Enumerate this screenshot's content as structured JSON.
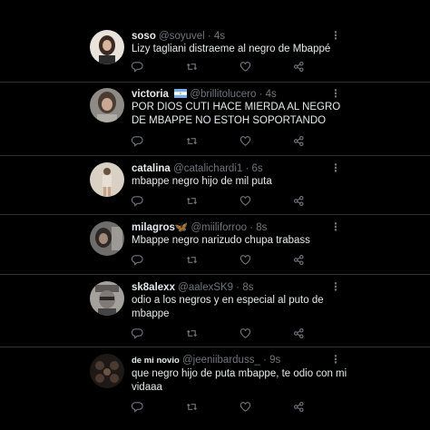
{
  "tweets": [
    {
      "name": "soso",
      "handle": "@soyuvel",
      "time": "4s",
      "text": "Lizy tagliani distraeme al negro de Mbappé",
      "avatar_color": "#d9cfc5"
    },
    {
      "name": "victoria",
      "handle": "@brillitolucero",
      "time": "4s",
      "text": "POR DIOS CUTI HACE MIERDA AL NEGRO DE MBAPPE NO ESTOH SOPORTANDO",
      "avatar_color": "#8d8a86",
      "flag": "argentina-flag-icon"
    },
    {
      "name": "catalina",
      "handle": "@catalichardi1",
      "time": "6s",
      "text": "mbappe negro hijo de mil puta",
      "avatar_color": "#cfc7b6"
    },
    {
      "name": "milagros🦋",
      "handle": "@miiliforroo",
      "time": "8s",
      "text": "Mbappe negro narizudo chupa trabass",
      "avatar_color": "#7c7a79"
    },
    {
      "name": "sk8alexx",
      "handle": "@aalexSK9",
      "time": "8s",
      "text": "odio a los negros y en especial al puto de mbappe",
      "avatar_color": "#9b9793"
    },
    {
      "name": "de mi novio",
      "handle": "@jeeniibarduss_",
      "time": "9s",
      "text": "que negro hijo de puta mbappe, te odio con mi vidaaa",
      "avatar_color": "#2a2220"
    }
  ],
  "separator": "·",
  "more_icon": "more-dots-icon",
  "action_icons": [
    "reply-icon",
    "retweet-icon",
    "like-icon",
    "share-icon"
  ],
  "colors": {
    "background": "#000000",
    "text": "#e7e9ea",
    "muted": "#71767b",
    "divider": "#2f3336"
  }
}
